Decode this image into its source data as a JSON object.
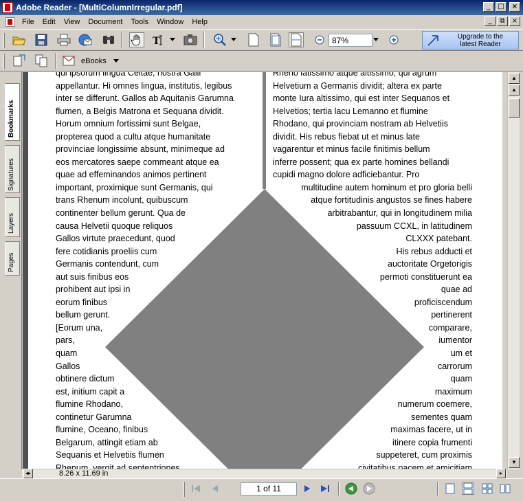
{
  "window": {
    "title": "Adobe Reader - [MultiColumnIrregular.pdf]",
    "buttons": [
      "_",
      "□",
      "×"
    ],
    "doc_buttons": [
      "_",
      "⧉",
      "×"
    ]
  },
  "menu": [
    "File",
    "Edit",
    "View",
    "Document",
    "Tools",
    "Window",
    "Help"
  ],
  "toolbar": {
    "zoom_value": "87%",
    "upgrade_label_1": "Upgrade to the",
    "upgrade_label_2": "latest Reader",
    "ebooks_label": "eBooks"
  },
  "nav_tabs": [
    "Bookmarks",
    "Signatures",
    "Layers",
    "Pages"
  ],
  "document": {
    "left_column": [
      "qui ipsorum lingua Celtae, nostra Galli",
      "appellantur.  Hi omnes lingua, institutis, legibus",
      "inter se differunt. Gallos ab Aquitanis Garumna",
      "flumen, a Belgis Matrona et Sequana dividit.",
      "Horum omnium fortissimi sunt Belgae,",
      "propterea quod a cultu atque humanitate",
      "provinciae longissime absunt, minimeque ad",
      "eos mercatores saepe commeant atque ea",
      "quae ad effeminandos animos pertinent",
      "important, proximique sunt Germanis, qui",
      "trans Rhenum incolunt, quibuscum",
      "continenter bellum gerunt.  Qua de",
      "causa Helvetii quoque reliquos",
      "Gallos virtute praecedunt, quod",
      "fere cotidianis proeliis cum",
      "Germanis contendunt, cum",
      "aut suis finibus eos",
      "prohibent aut ipsi in",
      "eorum finibus",
      "bellum gerunt.",
      "[Eorum una,",
      "pars,",
      "quam",
      "Gallos",
      "obtinere dictum",
      "est, initium capit a",
      "flumine Rhodano,",
      "continetur Garumna",
      "flumine, Oceano, finibus",
      "Belgarum, attingit etiam ab",
      "Sequanis et Helvetiis flumen",
      "Rhenum, vergit ad septentriones."
    ],
    "right_column": [
      "Rheno latissimo atque altissimo, qui agrum",
      "Helvetium a Germanis dividit; altera ex parte",
      "monte Iura altissimo, qui est inter Sequanos et",
      "Helvetios; tertia lacu Lemanno et flumine",
      "Rhodano, qui provinciam nostram ab Helvetiis",
      "dividit.  His rebus fiebat ut et minus late",
      "vagarentur et minus facile finitimis bellum",
      "inferre possent; qua ex parte homines bellandi",
      "cupidi magno dolore adficiebantur.  Pro",
      "multitudine autem hominum et pro gloria belli",
      "atque fortitudinis angustos se fines habere",
      "arbitrabantur, qui in longitudinem milia",
      "passuum CCXL, in latitudinem",
      "CLXXX patebant.",
      "His rebus adducti et",
      "auctoritate Orgetorigis",
      "permoti constituerunt ea",
      "quae ad",
      "proficiscendum",
      "pertinerent",
      "comparare,",
      "iumentor",
      "um et",
      "carrorum",
      "quam",
      "maximum",
      "numerum coemere,",
      "sementes quam",
      "maximas facere, ut in",
      "itinere copia frumenti",
      "suppeteret, cum proximis",
      "civitatibus pacem et amicitiam"
    ]
  },
  "bottom": {
    "page_size": "8.26 x 11.69 in",
    "page_indicator": "1 of 11"
  },
  "colors": {
    "titlebar": "#0a246a",
    "diamond": "#808080",
    "chrome": "#d4d0c8"
  }
}
